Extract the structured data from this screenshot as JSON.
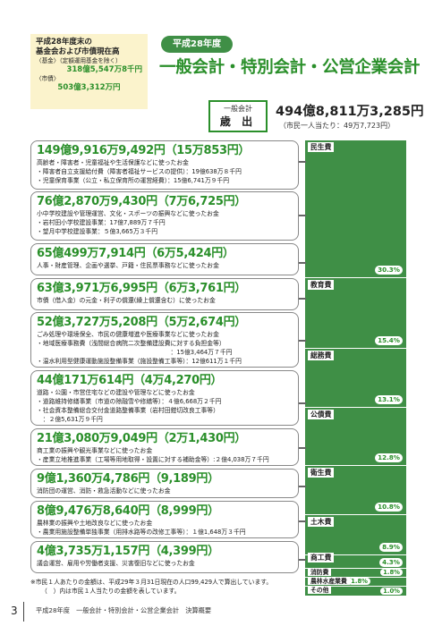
{
  "info": {
    "title1": "平成28年度末の",
    "title2": "基金会および市債現在高",
    "fund_label": "〈基金〉（定額運用基金を除く）",
    "fund_amount": "318億5,547万8千円",
    "bond_label": "〈市債〉",
    "bond_amount": "503億3,312万円"
  },
  "header": {
    "year_badge": "平成28年度",
    "title": "一般会計・特別会計・公営企業会計"
  },
  "summary": {
    "box_line1": "一般会計",
    "box_line2": "歳 出",
    "total": "494億8,811万3,285円",
    "per_capita": "（市民一人当たり：49万7,723円）"
  },
  "items": [
    {
      "amount": "149億9,916万9,492円（15万853円）",
      "lines": [
        "高齢者・障害者・児童福祉や生活保護などに使ったお金",
        "・障害者自立支援給付費（障害者福祉サービスの提供）：19億638万８千円",
        "・児童保育事業（公立・私立保育所の運営経費）：15億6,741万９千円"
      ]
    },
    {
      "amount": "76億2,870万9,430円（7万6,725円）",
      "lines": [
        "小中学校建設や管理運営、文化・スポーツの振興などに使ったお金",
        "・岩村田小学校建設事業：17億7,889万７千円",
        "・望月中学校建設事業：５億3,665万３千円"
      ]
    },
    {
      "amount": "65億499万7,914円（6万5,424円）",
      "lines": [
        "人事・財産管理、企画や選挙、戸籍・住民票事務などに使ったお金"
      ]
    },
    {
      "amount": "63億3,971万6,995円（6万3,761円）",
      "lines": [
        "市債（借入金）の元金・利子の償還(繰上償還含む）に使ったお金"
      ]
    },
    {
      "amount": "52億3,727万5,208円（5万2,674円）",
      "lines": [
        "ごみ処理や環境保全、市民の健康増進や医療事業などに使ったお金",
        "・地域医療事務費（浅間総合病院二次整備建設費に対する負担金等）",
        "　　　　　　　　　　　　　　　　　　　　　　：15億3,464万７千円",
        "・温水利用型健康運動施設整備事業（施設整備工事等）：12億611万１千円"
      ]
    },
    {
      "amount": "44億171万614円（4万4,270円）",
      "lines": [
        "道路・公園・市営住宅などの建設や管理などに使ったお金",
        "・道路維持修繕事業（市道の除融雪や修繕等）：４億6,668万２千円",
        "・社会資本整備総合交付金道路整備事業（岩村田鎧切改良工事等）",
        "　：２億5,631万９千円"
      ]
    },
    {
      "amount": "21億3,080万9,049円（2万1,430円）",
      "lines": [
        "商工業の振興や観光事業などに使ったお金",
        "・産業立地推進事業（工場等用地取得・設置に対する補助金等）:２億4,038万７千円"
      ]
    },
    {
      "amount": "9億1,360万4,786円（9,189円）",
      "lines": [
        "消防団の運営、消防・救急活動などに使ったお金"
      ]
    },
    {
      "amount": "8億9,476万8,640円（8,999円）",
      "lines": [
        "農林業の振興や土地改良などに使ったお金",
        "・農業用施設整備単独事業（用排水路等の改修工事等）：１億1,648万３千円"
      ]
    },
    {
      "amount": "4億3,735万1,157円（4,399円）",
      "lines": [
        "議会運営、雇用や労働者支援、災害復旧などに使ったお金"
      ]
    }
  ],
  "chart_data": {
    "type": "bar",
    "categories": [
      "民生費",
      "教育費",
      "総務費",
      "公債費",
      "衛生費",
      "土木費",
      "商工費",
      "消防費",
      "農林水産業費",
      "その他"
    ],
    "values": [
      30.3,
      15.4,
      13.1,
      12.8,
      10.8,
      8.9,
      4.3,
      1.8,
      1.8,
      1.0
    ],
    "value_labels": [
      "30.3%",
      "15.4%",
      "13.1%",
      "12.8%",
      "10.8%",
      "8.9%",
      "4.3%",
      "1.8%",
      "1.8%",
      "1.0%"
    ]
  },
  "footnotes": {
    "line1": "※市民１人あたりの金額は、平成29年３月31日現在の人口99,429人で算出しています。",
    "line2": "（　）内は市民１人当たりの金額を表しています。"
  },
  "footer": {
    "page_number": "3",
    "text": "平成28年度　一般会計・特別会計・公営企業会計　決算概要"
  },
  "colors": {
    "accent_green": "#2a8f2a",
    "bar_green": "#3f8f46",
    "info_bg": "#fbf3cc"
  }
}
